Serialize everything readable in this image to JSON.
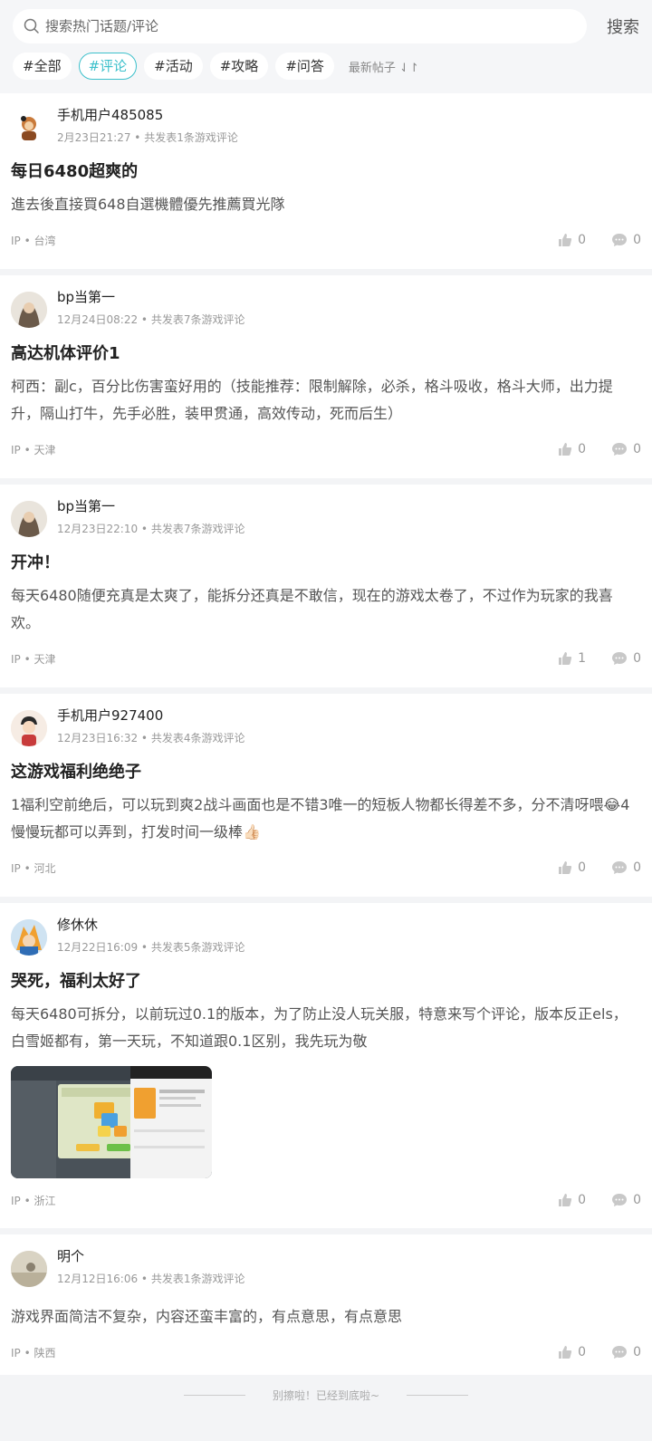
{
  "search": {
    "placeholder": "搜索热门话题/评论",
    "button": "搜索"
  },
  "tags": [
    "#全部",
    "#评论",
    "#活动",
    "#攻略",
    "#问答"
  ],
  "sort_label": "最新帖子 ⇃↾",
  "posts": [
    {
      "user": "手机用户485085",
      "meta": "2月23日21:27 • 共发表1条游戏评论",
      "title": "每日6480超爽的",
      "content": "進去後直接買648自選機體優先推薦買光隊",
      "ip": "IP • 台湾",
      "likes": "0",
      "comments": "0"
    },
    {
      "user": "bp当第一",
      "meta": "12月24日08:22 • 共发表7条游戏评论",
      "title": "高达机体评价1",
      "content": "柯西：副c，百分比伤害蛮好用的（技能推荐：限制解除，必杀，格斗吸收，格斗大师，出力提升，隔山打牛，先手必胜，装甲贯通，高效传动，死而后生）",
      "ip": "IP • 天津",
      "likes": "0",
      "comments": "0"
    },
    {
      "user": "bp当第一",
      "meta": "12月23日22:10 • 共发表7条游戏评论",
      "title": "开冲！",
      "content": "每天6480随便充真是太爽了，能拆分还真是不敢信，现在的游戏太卷了，不过作为玩家的我喜欢。",
      "ip": "IP • 天津",
      "likes": "1",
      "comments": "0"
    },
    {
      "user": "手机用户927400",
      "meta": "12月23日16:32 • 共发表4条游戏评论",
      "title": "这游戏福利绝绝子",
      "content": "1福利空前绝后，可以玩到爽2战斗画面也是不错3唯一的短板人物都长得差不多，分不清呀喂😂4慢慢玩都可以弄到，打发时间一级棒👍🏻",
      "ip": "IP • 河北",
      "likes": "0",
      "comments": "0"
    },
    {
      "user": "修休休",
      "meta": "12月22日16:09 • 共发表5条游戏评论",
      "title": "哭死，福利太好了",
      "content": "每天6480可拆分，以前玩过0.1的版本，为了防止没人玩关服，特意来写个评论，版本反正els，白雪姬都有，第一天玩，不知道跟0.1区别，我先玩为敬",
      "ip": "IP • 浙江",
      "likes": "0",
      "comments": "0"
    },
    {
      "user": "明个",
      "meta": "12月12日16:06 • 共发表1条游戏评论",
      "title": "",
      "content": "游戏界面简洁不复杂，内容还蛮丰富的，有点意思，有点意思",
      "ip": "IP • 陕西",
      "likes": "0",
      "comments": "0"
    }
  ],
  "end_text": "别擦啦！已经到底啦~",
  "colors": {
    "accent": "#3cc0cb",
    "background": "#f3f4f6"
  }
}
